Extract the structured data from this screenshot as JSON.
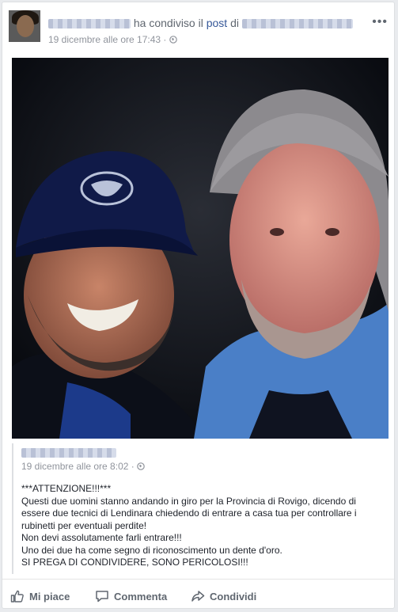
{
  "post": {
    "shared_text": "ha condiviso il",
    "post_word": "post",
    "of_word": "di",
    "date": "19 dicembre alle ore 17:43 · "
  },
  "shared_post": {
    "date": "19 dicembre alle ore 8:02 · ",
    "message_lines": [
      "***ATTENZIONE!!!***",
      "Questi due uomini stanno andando in giro per la Provincia di Rovigo, dicendo di",
      "essere due tecnici di Lendinara chiedendo di entrare a casa tua per controllare i",
      "rubinetti per eventuali perdite!",
      "Non devi assolutamente farli entrare!!!",
      "Uno dei due ha come segno di riconoscimento un dente d'oro.",
      "SI PREGA DI CONDIVIDERE, SONO PERICOLOSI!!!"
    ]
  },
  "actions": {
    "like": "Mi piace",
    "comment": "Commenta",
    "share": "Condividi"
  },
  "icons": {
    "privacy": "globe-icon",
    "more": "more-options-icon",
    "like": "thumbs-up-icon",
    "comment": "comment-icon",
    "share": "share-icon"
  },
  "colors": {
    "link": "#365899",
    "muted": "#90949c",
    "action": "#606770"
  }
}
